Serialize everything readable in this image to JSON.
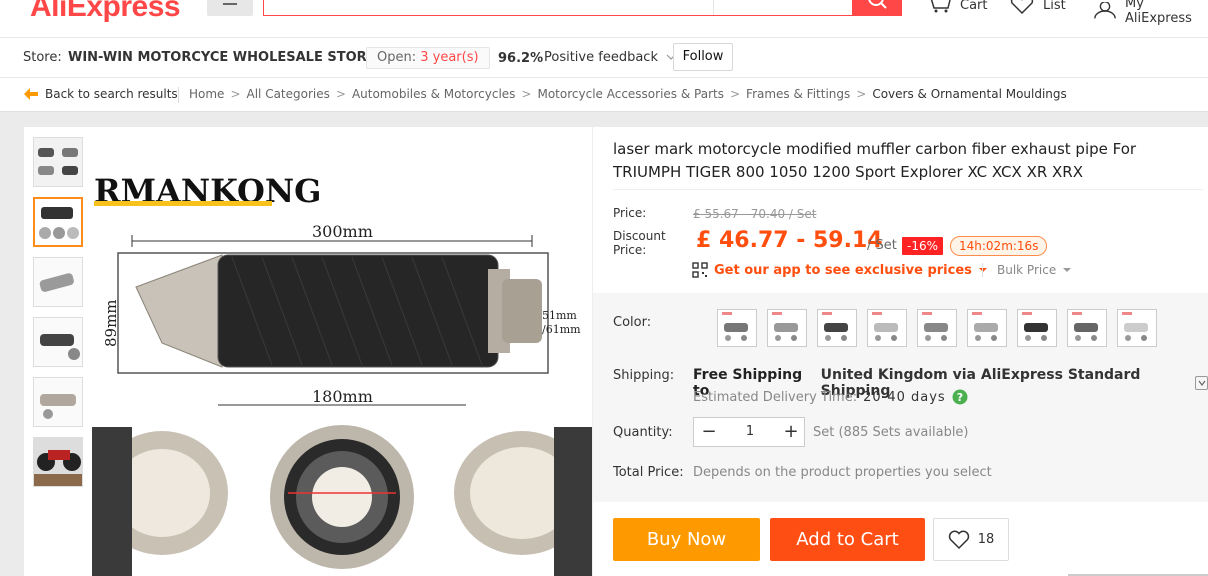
{
  "header": {
    "logo": "AliExpress",
    "links": [
      {
        "label": "Cart",
        "icon": "cart-icon"
      },
      {
        "label": "List",
        "icon": "heart-icon"
      },
      {
        "label": "My AliExpress",
        "icon": "user-icon"
      }
    ]
  },
  "store": {
    "label": "Store:",
    "name": "WIN-WIN MOTORCYCE WHOLESALE STORE",
    "open_label": "Open:",
    "open_years": "3 year(s)",
    "feedback_pct": "96.2%",
    "feedback_label": "Positive feedback",
    "follow_label": "Follow"
  },
  "breadcrumb": {
    "back_label": "Back to search results",
    "items": [
      "Home",
      "All Categories",
      "Automobiles & Motorcycles",
      "Motorcycle Accessories & Parts",
      "Frames & Fittings",
      "Covers & Ornamental Mouldings"
    ],
    "sep": ">"
  },
  "product": {
    "title": "laser mark motorcycle modified muffler carbon fiber exhaust pipe For TRIUMPH TIGER 800 1050 1200 Sport Explorer XC XCX XR XRX",
    "image": {
      "brand": "RMANKONG",
      "dim_length": "300mm",
      "dim_body": "180mm",
      "dim_height": "89mm",
      "dim_outlet_1": "51mm",
      "dim_outlet_2": "/61mm"
    },
    "price_label": "Price:",
    "old_price": "£ 55.67 - 70.40 / Set",
    "discount_label_1": "Discount",
    "discount_label_2": "Price:",
    "price": "£ 46.77 - 59.14",
    "per_set": "/ Set",
    "discount": "-16%",
    "countdown": "14h:02m:16s",
    "app_promo": "Get our app to see exclusive prices",
    "bulk_price": "Bulk Price"
  },
  "options": {
    "color_label": "Color:",
    "color_count": 9,
    "shipping_label": "Shipping:",
    "shipping_free": "Free Shipping to",
    "shipping_dest": "United Kingdom via AliExpress Standard Shipping",
    "delivery_label": "Estimated Delivery Time:",
    "delivery_days": "20-40 days",
    "quantity_label": "Quantity:",
    "quantity_value": "1",
    "availability": "Set (885 Sets available)",
    "total_label": "Total Price:",
    "total_value": "Depends on the product properties you select"
  },
  "actions": {
    "buy_now": "Buy Now",
    "add_to_cart": "Add to Cart",
    "wish_count": "18"
  },
  "colors": {
    "brand_red": "#ff4747",
    "price_orange": "#ff4e0e",
    "buy_orange": "#ff9900",
    "cart_red": "#ff4e14"
  }
}
